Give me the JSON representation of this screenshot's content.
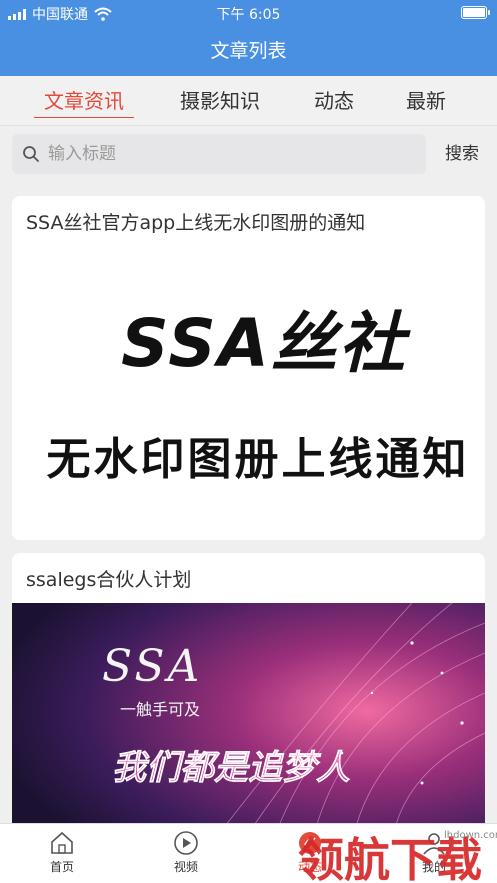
{
  "status": {
    "carrier": "中国联通",
    "time": "下午 6:05"
  },
  "nav": {
    "title": "文章列表"
  },
  "tabs": [
    "文章资讯",
    "摄影知识",
    "动态",
    "最新"
  ],
  "search": {
    "placeholder": "输入标题",
    "button": "搜索"
  },
  "articles": [
    {
      "title": "SSA丝社官方app上线无水印图册的通知",
      "image_text": {
        "logo": "SSA丝社",
        "caption": "无水印图册上线通知"
      }
    },
    {
      "title": "ssalegs合伙人计划",
      "image_text": {
        "logo": "SSA",
        "tagline": "一触手可及",
        "slogan": "我们都是追梦人"
      }
    }
  ],
  "bottom_nav": [
    "首页",
    "视频",
    "动态",
    "我的"
  ],
  "watermark": {
    "text": "领航下载",
    "site": "lhdown.com"
  },
  "colors": {
    "primary": "#4a90e2",
    "accent": "#e24a3b"
  }
}
